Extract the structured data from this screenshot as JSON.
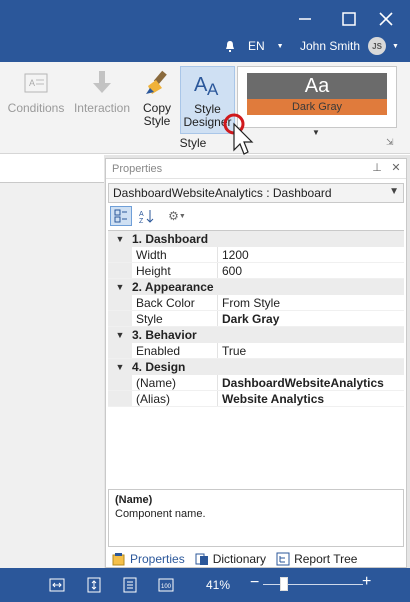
{
  "window": {
    "user_name": "John Smith",
    "user_initials": "JS",
    "language": "EN"
  },
  "ribbon": {
    "conditions_label": "Conditions",
    "interaction_label": "Interaction",
    "copy_style_label": "Copy\nStyle",
    "style_designer_label": "Style\nDesigner",
    "gallery_preview_text": "Aa",
    "gallery_style_name": "Dark Gray",
    "group_label": "Style"
  },
  "properties": {
    "title": "Properties",
    "selected_component": "DashboardWebsiteAnalytics : Dashboard",
    "categories": [
      {
        "label": "1. Dashboard",
        "rows": [
          {
            "name": "Width",
            "value": "1200",
            "bold": false
          },
          {
            "name": "Height",
            "value": "600",
            "bold": false
          }
        ]
      },
      {
        "label": "2. Appearance",
        "rows": [
          {
            "name": "Back Color",
            "value": "From Style",
            "bold": false
          },
          {
            "name": "Style",
            "value": "Dark Gray",
            "bold": true
          }
        ]
      },
      {
        "label": "3. Behavior",
        "rows": [
          {
            "name": "Enabled",
            "value": "True",
            "bold": false
          }
        ]
      },
      {
        "label": "4. Design",
        "rows": [
          {
            "name": "(Name)",
            "value": "DashboardWebsiteAnalytics",
            "bold": true
          },
          {
            "name": "(Alias)",
            "value": "Website Analytics",
            "bold": true
          }
        ]
      }
    ],
    "description_title": "(Name)",
    "description_text": "Component name.",
    "tabs": [
      "Properties",
      "Dictionary",
      "Report Tree"
    ]
  },
  "status": {
    "zoom": "41%",
    "zoom_fraction": 0.41
  },
  "colors": {
    "accent": "#2b579a",
    "style_swatch_dark": "#6b6b6b",
    "style_swatch_orange": "#e07b3c"
  }
}
